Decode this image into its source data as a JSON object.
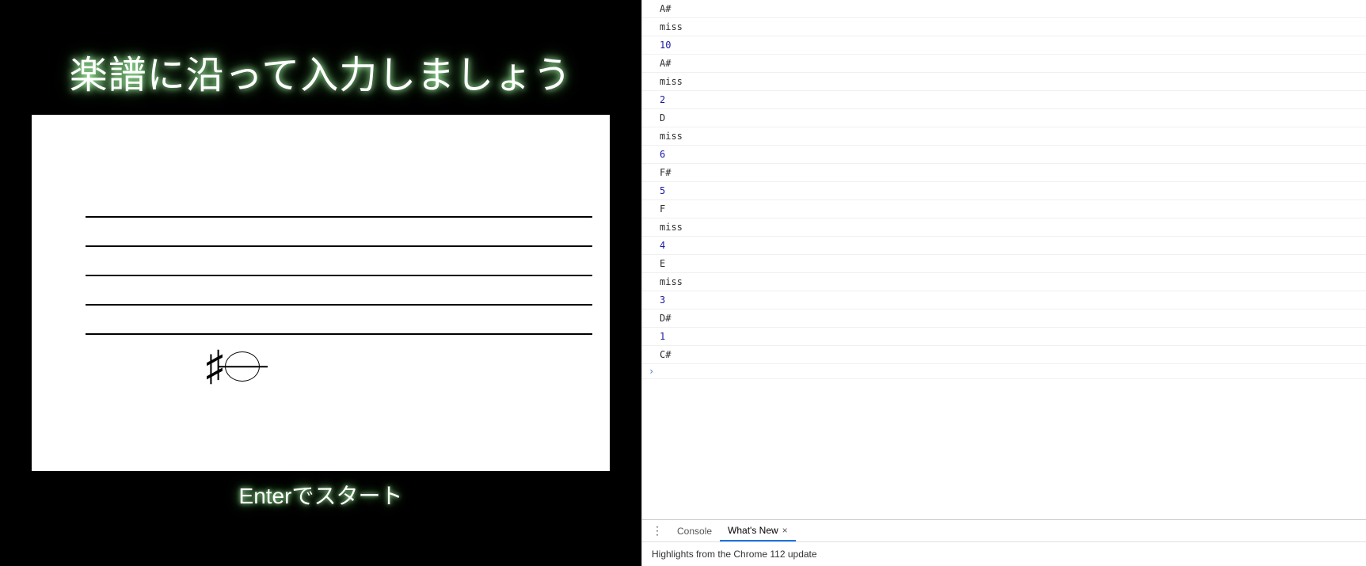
{
  "game": {
    "title": "楽譜に沿って入力しましょう",
    "start_text": "Enterでスタート",
    "note": {
      "accidental": "♯"
    }
  },
  "console": {
    "logs": [
      {
        "text": "A#",
        "type": "str"
      },
      {
        "text": "miss",
        "type": "str"
      },
      {
        "text": "10",
        "type": "num"
      },
      {
        "text": "A#",
        "type": "str"
      },
      {
        "text": "miss",
        "type": "str"
      },
      {
        "text": "2",
        "type": "num"
      },
      {
        "text": "D",
        "type": "str"
      },
      {
        "text": "miss",
        "type": "str"
      },
      {
        "text": "6",
        "type": "num"
      },
      {
        "text": "F#",
        "type": "str"
      },
      {
        "text": "5",
        "type": "num"
      },
      {
        "text": "F",
        "type": "str"
      },
      {
        "text": "miss",
        "type": "str"
      },
      {
        "text": "4",
        "type": "num"
      },
      {
        "text": "E",
        "type": "str"
      },
      {
        "text": "miss",
        "type": "str"
      },
      {
        "text": "3",
        "type": "num"
      },
      {
        "text": "D#",
        "type": "str"
      },
      {
        "text": "1",
        "type": "num"
      },
      {
        "text": "C#",
        "type": "str"
      }
    ],
    "prompt": "›"
  },
  "drawer": {
    "tab_console": "Console",
    "tab_whatsnew": "What's New",
    "close": "×",
    "content": "Highlights from the Chrome 112 update"
  }
}
